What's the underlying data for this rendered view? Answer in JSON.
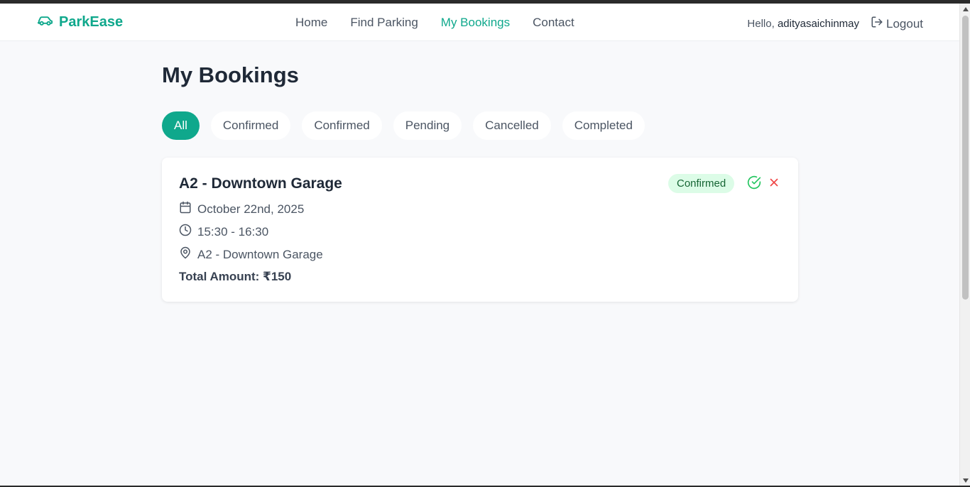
{
  "brand": {
    "name": "ParkEase",
    "icon": "car-icon",
    "color": "#0fa88c"
  },
  "nav": {
    "links": [
      {
        "label": "Home",
        "active": false
      },
      {
        "label": "Find Parking",
        "active": false
      },
      {
        "label": "My Bookings",
        "active": true
      },
      {
        "label": "Contact",
        "active": false
      }
    ]
  },
  "user": {
    "greeting_prefix": "Hello,",
    "username": "adityasaichinmay",
    "logout_label": "Logout",
    "logout_icon": "logout-icon"
  },
  "page": {
    "title": "My Bookings"
  },
  "filters": [
    {
      "label": "All",
      "active": true
    },
    {
      "label": "Confirmed",
      "active": false
    },
    {
      "label": "Confirmed",
      "active": false
    },
    {
      "label": "Pending",
      "active": false
    },
    {
      "label": "Cancelled",
      "active": false
    },
    {
      "label": "Completed",
      "active": false
    }
  ],
  "bookings": [
    {
      "title": "A2 - Downtown Garage",
      "status": "Confirmed",
      "date": "October 22nd, 2025",
      "time": "15:30 - 16:30",
      "location": "A2 - Downtown Garage",
      "total": "Total Amount: ₹150",
      "icons": {
        "date": "calendar-icon",
        "time": "clock-icon",
        "location": "map-pin-icon",
        "confirm": "check-circle-icon",
        "cancel": "x-icon"
      }
    }
  ],
  "colors": {
    "accent": "#0fa88c",
    "status_bg": "#dcfce7",
    "status_text": "#166534",
    "cancel": "#ef4444",
    "confirm": "#22c55e"
  }
}
